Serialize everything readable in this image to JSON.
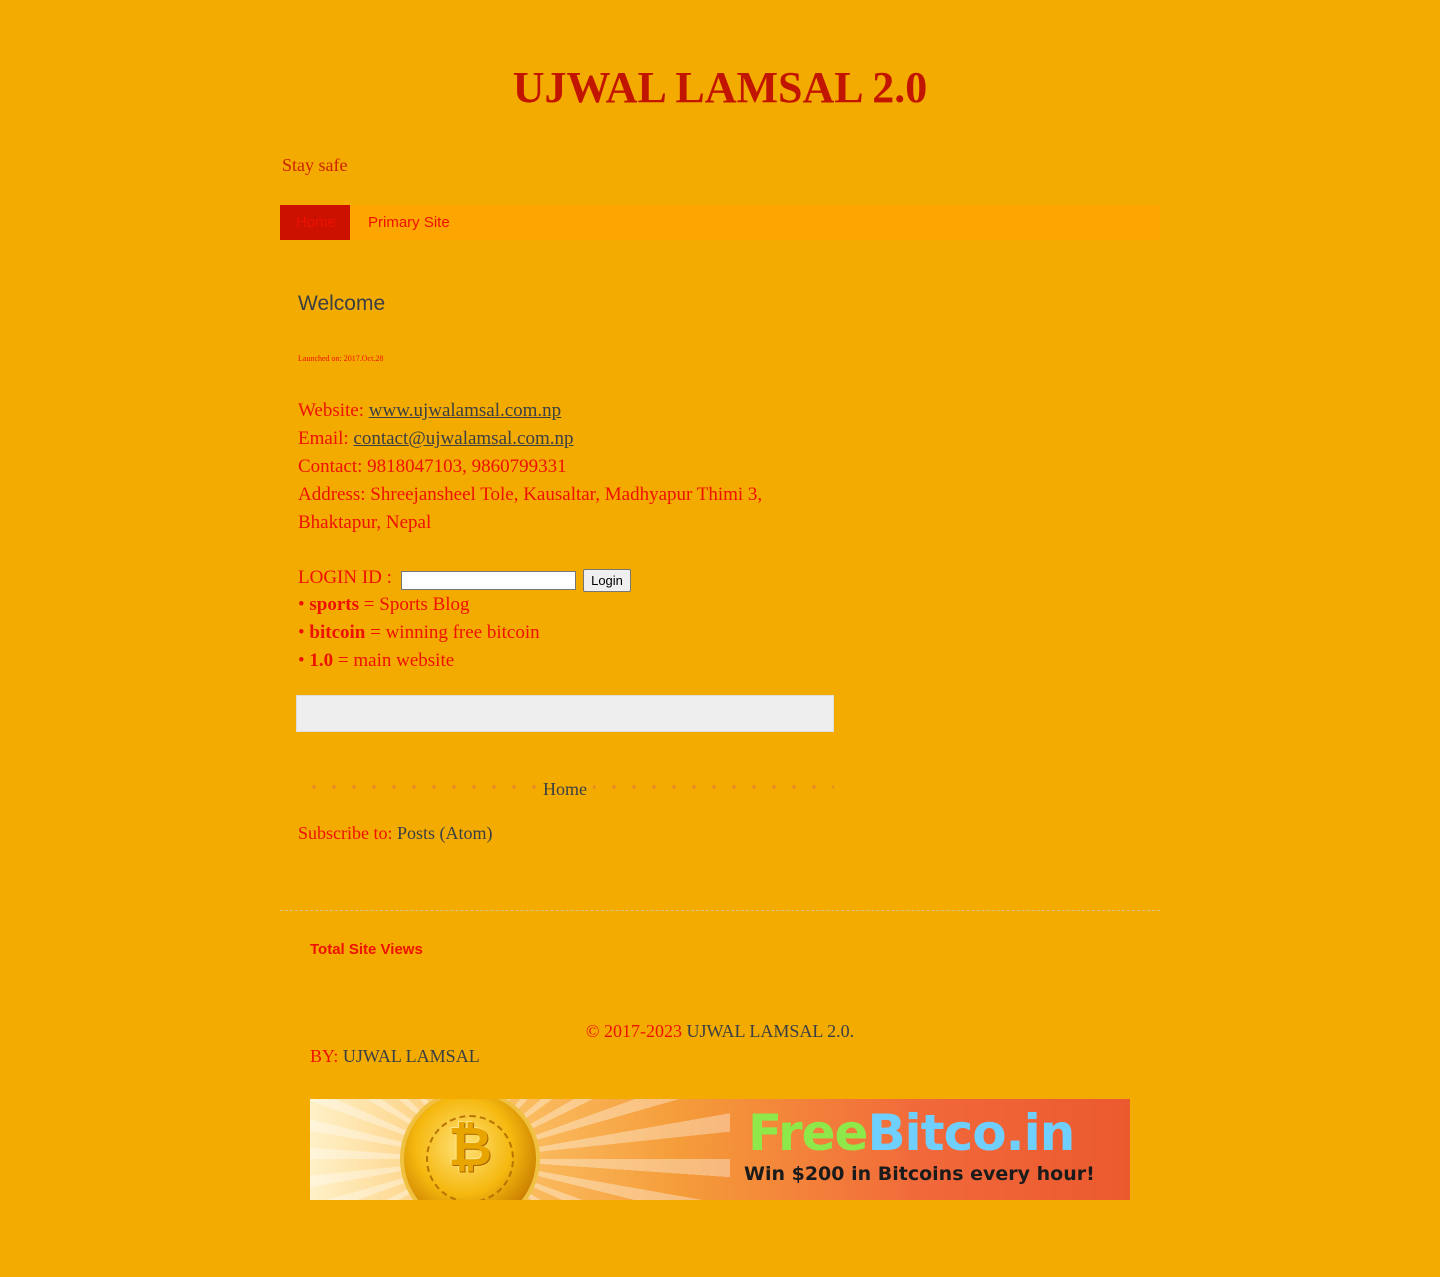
{
  "header": {
    "title": "UJWAL LAMSAL 2.0",
    "tagline": "Stay safe"
  },
  "nav": {
    "items": [
      {
        "label": "Home"
      },
      {
        "label": "Primary Site"
      }
    ]
  },
  "post": {
    "title": "Welcome",
    "launched": "Launched on: 2017.Oct.28",
    "website_label": "Website: ",
    "website_link": "www.ujwalamsal.com.np",
    "email_label": "Email: ",
    "email_link": "contact@ujwalamsal.com.np",
    "contact": "Contact: 9818047103, 9860799331",
    "address": "Address: Shreejansheel Tole, Kausaltar, Madhyapur Thimi 3, Bhaktapur, Nepal",
    "login_label": "LOGIN ID : ",
    "login_input_value": "",
    "login_button": "Login",
    "bullets": [
      {
        "dot": "• ",
        "key": "sports",
        "desc": " = Sports Blog"
      },
      {
        "dot": "• ",
        "key": "bitcoin",
        "desc": " = winning free bitcoin"
      },
      {
        "dot": "• ",
        "key": "1.0",
        "desc": " = main website"
      }
    ]
  },
  "pager": {
    "home": "Home"
  },
  "subscribe": {
    "label": "Subscribe to: ",
    "link": "Posts (Atom)"
  },
  "sidebar": {
    "views_title": "Total Site Views"
  },
  "footer": {
    "copyright": "© 2017-2023 ",
    "site_name": "UJWAL LAMSAL 2.0",
    "period": ".",
    "by_label": "BY: ",
    "by_name": "UJWAL LAMSAL"
  },
  "banner": {
    "brand_free": "Free",
    "brand_bit": "Bitco.in",
    "subtitle": "Win $200 in Bitcoins every hour!",
    "coin_glyph": "₿"
  },
  "colors": {
    "background": "#f4ab00",
    "accent": "#ee1100",
    "title": "#c21500",
    "link": "#3a3f44"
  }
}
